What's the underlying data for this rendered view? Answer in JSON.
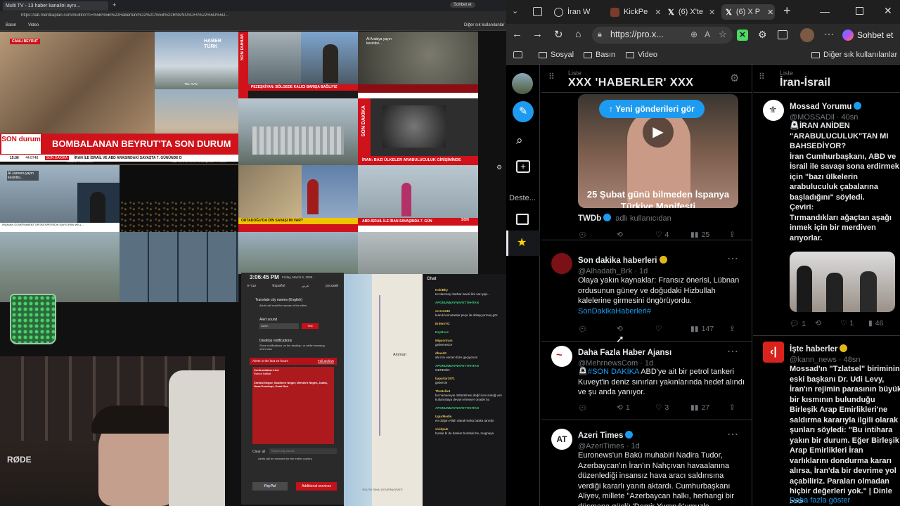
{
  "left": {
    "tab_title": "Multi TV - 13 haber kanalini aynı...",
    "url": "https://lab.meritkaplan.com/multitv/?c=%5B%5B%22Haberturk%22%2C%5B%22RNVNUSUF0%22%5D%5D...",
    "bookmarks": [
      "Basın",
      "Video"
    ],
    "other_bookmarks": "Diğer sık kullanılanlar",
    "sohbet": "Sohbet et",
    "tiles": {
      "haberturk_logo": "HABER TÜRK",
      "canli": "CANLI",
      "beyrut": "BEYRUT",
      "tel_aviv": "TEL AVIV",
      "gizem": "GİZEM YÜREMEK",
      "abd_israil_banner": "ABD-İSRAİL İRAN SAVAŞINDA 7. GÜN",
      "son_durum_logo": "SON durum",
      "main_banner": "BOMBALANAN BEYRUT'TA SON DURUM",
      "ticker_time": "15:06",
      "ticker_val": "44.0748",
      "ticker_label": "SON DAKİKA",
      "ticker_text": "İRAN İLE İSRAİL VE ABD ARASINDAKİ SAVAŞTA 7. GÜNÜNDE D",
      "son_durum_vertical": "SON DURUM",
      "pezeshkian": "PEZEŞKİYAN: BÖLGEDE KALICI BARIŞA BAĞLIYIZ",
      "son_dakika_vertical": "SON DAKİKA",
      "iran_banner": "İRAN: BAZI ÜLKELER ARABULUCULUK GİRİŞİMİNDE",
      "alarabiya": "Al Arabiya yayın kesintisi...",
      "aljazeera": "Al Jazeera yayın kesintisi...",
      "ortadogu": "ORTADOĞU'DA DİN SAVAŞI MI VAR?",
      "son_canli": "SON",
      "abd_israil_bottom": "ABD-İSRAİL İLE İRAN SAVAŞINDA 7. GÜN",
      "ebanner": "IRANIAN GOVERNMENT SPOKESPERSON SAYS IRAN WILL..."
    },
    "alerts": {
      "time": "3:06:45 PM",
      "date": "Friday, March 6, 2026",
      "langs": [
        "עברית",
        "Español",
        "عربي",
        "русский"
      ],
      "city_names_label": "Translate city names (English)",
      "city_names_desc": "Alerts will read the names of the cities",
      "alert_sound": "Alert sound",
      "sound_value": "Alarm",
      "test_label": "Test",
      "desktop_label": "Desktop notifications",
      "desktop_desc": "Show notifications on the desktop, or while browsing other tabs",
      "alerts_header": "Alerts in the last 24 hours",
      "full_archive": "Full archive",
      "item1_title": "Confrontation Line",
      "item1_city": "Ramot Naftali",
      "item2_title": "Central Negev, Southern Negev, Western Negev, Judea, Gaza Envelope, Dead Sea",
      "clear_all": "Clear all",
      "search_placeholder": "Search city names",
      "renewed": "Alerts will be renewed for the entire country.",
      "paypal": "PayPal",
      "additional": "Additional services"
    },
    "map_labels": [
      "Amman",
      "SOUTH SINAI GOVERNORATE"
    ],
    "chat": {
      "title": "Chat",
      "messages": [
        {
          "user": "KokiBky",
          "text": "Kızılasmaçı barbar kaviri ilini sarı pipi..."
        },
        {
          "user": "APONUNMAYNAFETTAHTAN",
          "text": ""
        },
        {
          "user": "ecrr12345",
          "text": "kıanık komutanlar peçe ile dolaşıyormuş göz"
        },
        {
          "user": "ErdemYG",
          "text": ""
        },
        {
          "user": "DeyRess",
          "text": ""
        },
        {
          "user": "MigoorIram",
          "text": "gebemesice"
        },
        {
          "user": "dbasd0",
          "text": "abi izin versen bize geçiyorum"
        },
        {
          "user": "APONUNMAYNAFETTAHTAN",
          "text": "GERDSİN"
        },
        {
          "user": "baparlar1971",
          "text": "gebersin"
        },
        {
          "user": "TheHelix4",
          "text": "bu hamaneyie öldürülmesi değil ironi sokağ veri kutlamalaya devam etmeyer onaide bu"
        },
        {
          "user": "APONUNMAYNAFETTAHTAN",
          "text": ""
        },
        {
          "user": "UgurMedin",
          "text": "en doğan Allah olarak kıska baska tanrıdır"
        },
        {
          "user": "vividpub",
          "text": "bunlar bi de banker bombalı he, magnaya"
        }
      ]
    },
    "rode": "RØDE"
  },
  "right": {
    "tabs": [
      {
        "label": "İran W",
        "icon": "globe-icon"
      },
      {
        "label": "KickPe",
        "icon": "kick-icon"
      },
      {
        "label": "(6) X'te",
        "icon": "x-icon"
      },
      {
        "label": "(6) X P",
        "icon": "x-icon"
      }
    ],
    "url": "https://pro.x...",
    "sohbet": "Sohbet et",
    "bookmarks": [
      "Sosyal",
      "Basın",
      "Video"
    ],
    "other_bookmarks": "Diğer sık kullanılanlar",
    "sidebar_label": "Deste...",
    "col1": {
      "list_label": "Liste",
      "title": "XXX 'HABERLER' XXX",
      "new_posts": "Yeni gönderileri gör",
      "video_caption": "25 Şubat günü bilmeden İspanya Türkiye Manifesti",
      "tweet0": {
        "name": "TWDb",
        "handle": "adlı kullanıcıdan",
        "reply": "",
        "retweet": "",
        "like": "4",
        "views": "25"
      },
      "tweet1": {
        "name": "Son dakika haberleri",
        "handle": "@Alhadath_Brk",
        "time": "1d",
        "text": "Olaya yakın kaynaklar: Fransız önerisi, Lübnan ordusunun güney ve doğudaki Hizbullah kalelerine girmesini öngörüyordu.",
        "hashtag": "SonDakikaHaberleri#",
        "views": "147"
      },
      "tweet2": {
        "name": "Daha Fazla Haber Ajansı",
        "handle": "@MehrnewsCom",
        "time": "1d",
        "hashtag": "#SON DAKİKA",
        "text": "ABD'ye ait bir petrol tankeri Kuveyt'in deniz sınırları yakınlarında hedef alındı ve şu anda yanıyor.",
        "retweet": "1",
        "like": "3",
        "views": "27"
      },
      "tweet3": {
        "name": "Azeri Times",
        "handle": "@AzeriTimes",
        "time": "1d",
        "text": "Euronews'un Bakü muhabiri Nadira Tudor, Azerbaycan'ın İran'ın Nahçıvan havaalanına düzenlediği insansız hava aracı saldırısına verdiği kararlı yanıtı aktardı. Cumhurbaşkanı Aliyev, millete \"Azerbaycan halkı, herhangi bir düşmana güçlü 'Demir Yumruk'umuzla"
      }
    },
    "col2": {
      "list_label": "Liste",
      "title": "İran-İsrail",
      "tweet1": {
        "name": "Mossad Yorumu",
        "handle": "@MOSSADil",
        "time": "40sn",
        "text1": "İRAN ANİDEN \"ARABULUCULUK\"TAN MI BAHSEDİYOR?",
        "text2": "İran Cumhurbaşkanı, ABD ve İsrail ile savaşı sona erdirmek için \"bazı ülkelerin arabuluculuk çabalarına başladığını\" söyledi.",
        "text3": "Çeviri:",
        "text4": "Tırmandıkları ağaçtan aşağı inmek için bir merdiven arıyorlar.",
        "reply": "1",
        "like": "1",
        "views": "46"
      },
      "tweet2": {
        "name": "İşte haberler",
        "handle": "@kann_news",
        "time": "48sn",
        "text": "Mossad'ın \"Tzlatsel\" biriminin eski başkanı Dr. Udi Levy, İran'ın rejimin parasının büyük bir kısmının bulunduğu Birleşik Arap Emirlikleri'ne saldırma kararıyla ilgili olarak şunları söyledi: \"Bu intihara yakın bir durum. Eğer Birleşik Arap Emirlikleri İran varlıklarını dondurma kararı alırsa, İran'da bir devrime yol açabiliriz. Paraları olmadan hiçbir değerleri yok.\" | Dinle >>>",
        "more": "Daha fazla göster"
      }
    }
  },
  "colors": {
    "x_blue": "#1d9bf0",
    "x_border": "#2f3336",
    "x_muted": "#71767b",
    "news_red": "#d0121b",
    "gold_badge": "#e2b719"
  }
}
